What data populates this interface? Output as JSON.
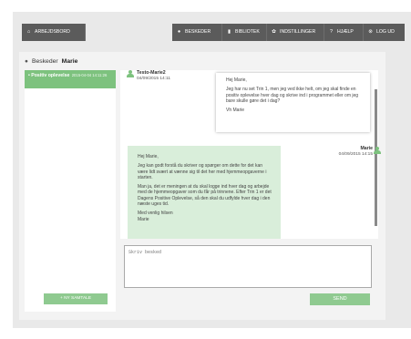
{
  "nav": {
    "home": "ARBEJDSBORD",
    "messages": "BESKEDER",
    "library": "BIBLIOTEK",
    "settings": "INDSTILLINGER",
    "help": "HJÆLP",
    "logout": "LOG UD"
  },
  "breadcrumb": {
    "section": "Beskeder",
    "name": "Marie"
  },
  "conversations": [
    {
      "title": "Positiv oplevelse",
      "date": "2015-04-04 14:11:26"
    }
  ],
  "new_conversation_label": "+ NY SAMTALE",
  "messages": [
    {
      "sender": "Testo-Marie2",
      "date": "04/09/2015 14:11",
      "paragraphs": [
        "Hej Marie,",
        "Jeg har nu set Trin 1, men jeg ved ikke helt, om jeg skal finde en positiv oplevelse hver dag og skrive ind i programmet eller om jeg bare skulle gøre det i dag?",
        "Vh Marie"
      ]
    },
    {
      "sender": "Marie",
      "date": "04/09/2015 14:15",
      "paragraphs": [
        "Hej Marie,",
        "Jeg kan godt forstå du skriver og spørger om dette for det kan være lidt svært at vænne sig til det her med hjemmeopgaverne i starten.",
        "Man ja, det er meningen at du skal logge ind hver dag og arbejde med de hjemmeopgaver som du får på trinnene. Efter Trin 1 er det Dagens Positive Oplevelse, så den skal du udfylde hver dag i den næste uges tid.",
        "Med venlig hilsen",
        "Marie"
      ]
    }
  ],
  "composer": {
    "placeholder": "Skriv besked",
    "send_label": "SEND"
  },
  "colors": {
    "nav": "#5b5b5b",
    "accent_green": "#7dc27e",
    "reply_bubble": "#d9eeda"
  }
}
